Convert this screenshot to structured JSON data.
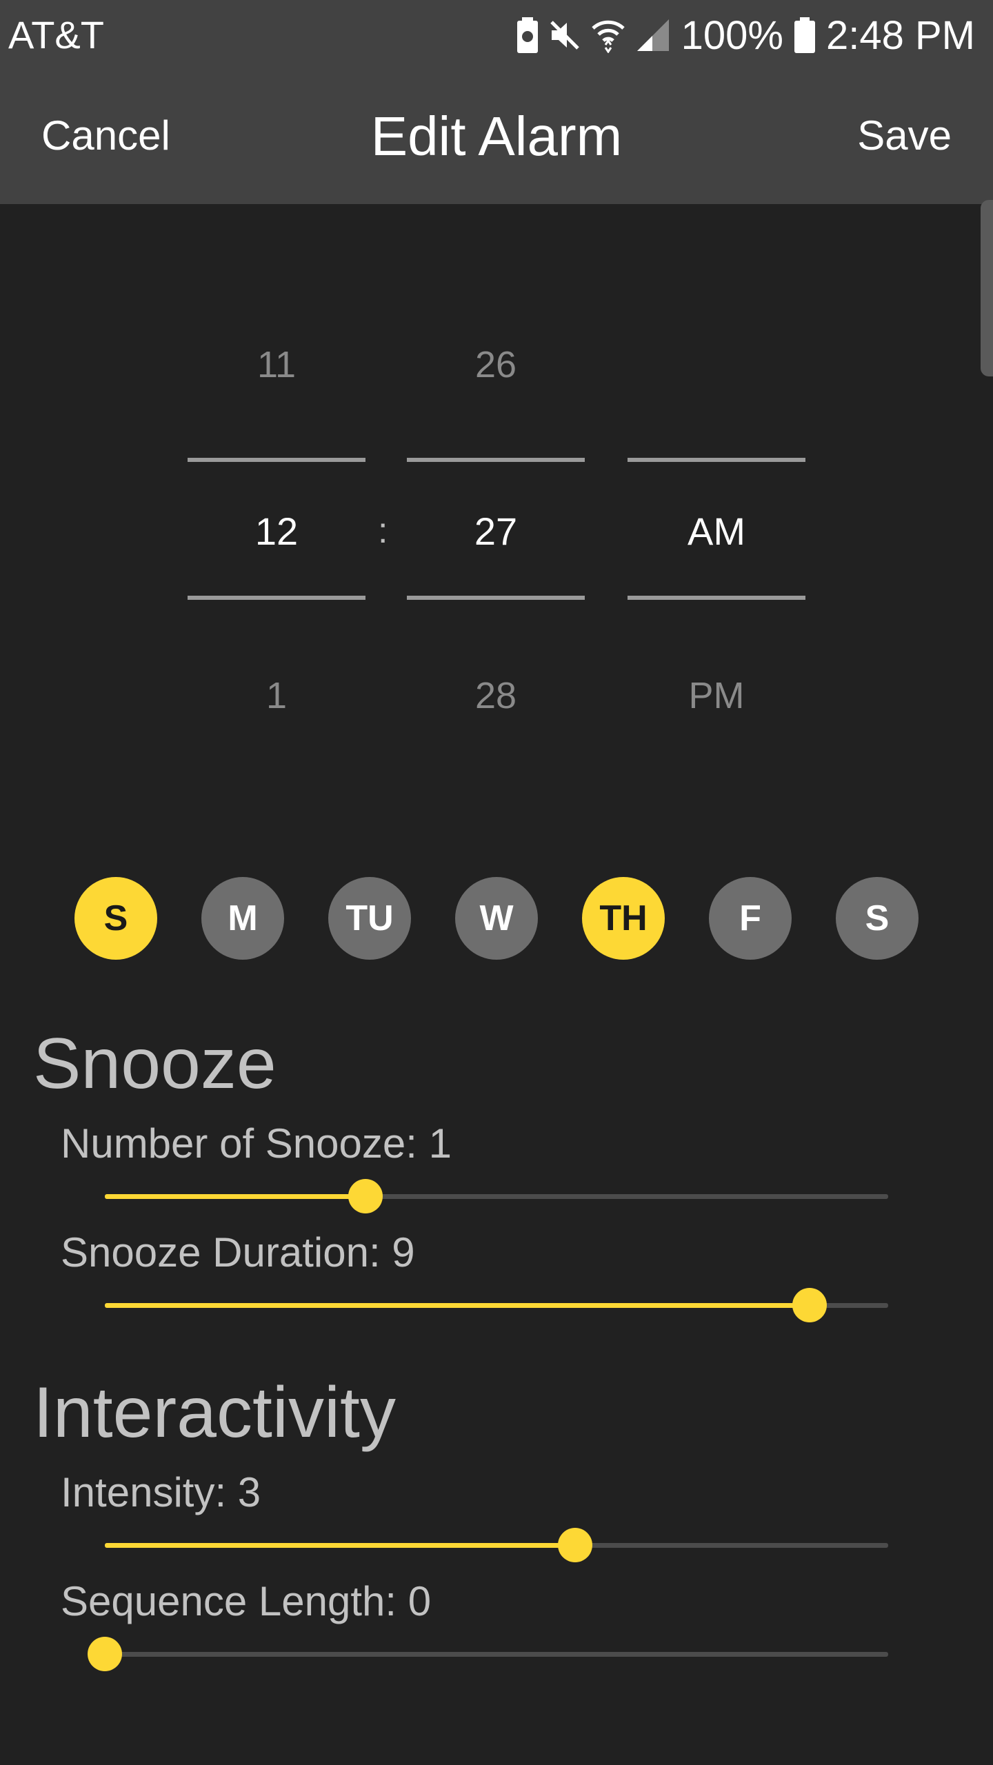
{
  "status_bar": {
    "carrier": "AT&T",
    "battery_percent": "100%",
    "time": "2:48 PM",
    "icons": [
      "battery-saver-icon",
      "mute-icon",
      "wifi-icon",
      "signal-icon",
      "battery-icon"
    ]
  },
  "app_bar": {
    "cancel_label": "Cancel",
    "title": "Edit Alarm",
    "save_label": "Save"
  },
  "time_picker": {
    "hour": {
      "prev": "11",
      "current": "12",
      "next": "1"
    },
    "separator": ":",
    "minute": {
      "prev": "26",
      "current": "27",
      "next": "28"
    },
    "period": {
      "prev": "",
      "current": "AM",
      "next": "PM"
    }
  },
  "days": [
    {
      "label": "S",
      "selected": true
    },
    {
      "label": "M",
      "selected": false
    },
    {
      "label": "TU",
      "selected": false
    },
    {
      "label": "W",
      "selected": false
    },
    {
      "label": "TH",
      "selected": true
    },
    {
      "label": "F",
      "selected": false
    },
    {
      "label": "S",
      "selected": false
    }
  ],
  "snooze": {
    "title": "Snooze",
    "number": {
      "label": "Number of Snooze: 1",
      "fraction": 0.333
    },
    "duration": {
      "label": "Snooze Duration: 9",
      "fraction": 0.9
    }
  },
  "interactivity": {
    "title": "Interactivity",
    "intensity": {
      "label": "Intensity: 3",
      "fraction": 0.6
    },
    "sequence": {
      "label": "Sequence Length: 0",
      "fraction": 0.0
    }
  },
  "colors": {
    "accent": "#fdd835",
    "background": "#212121",
    "app_bar": "#424242",
    "day_inactive": "#6e6e6e"
  }
}
